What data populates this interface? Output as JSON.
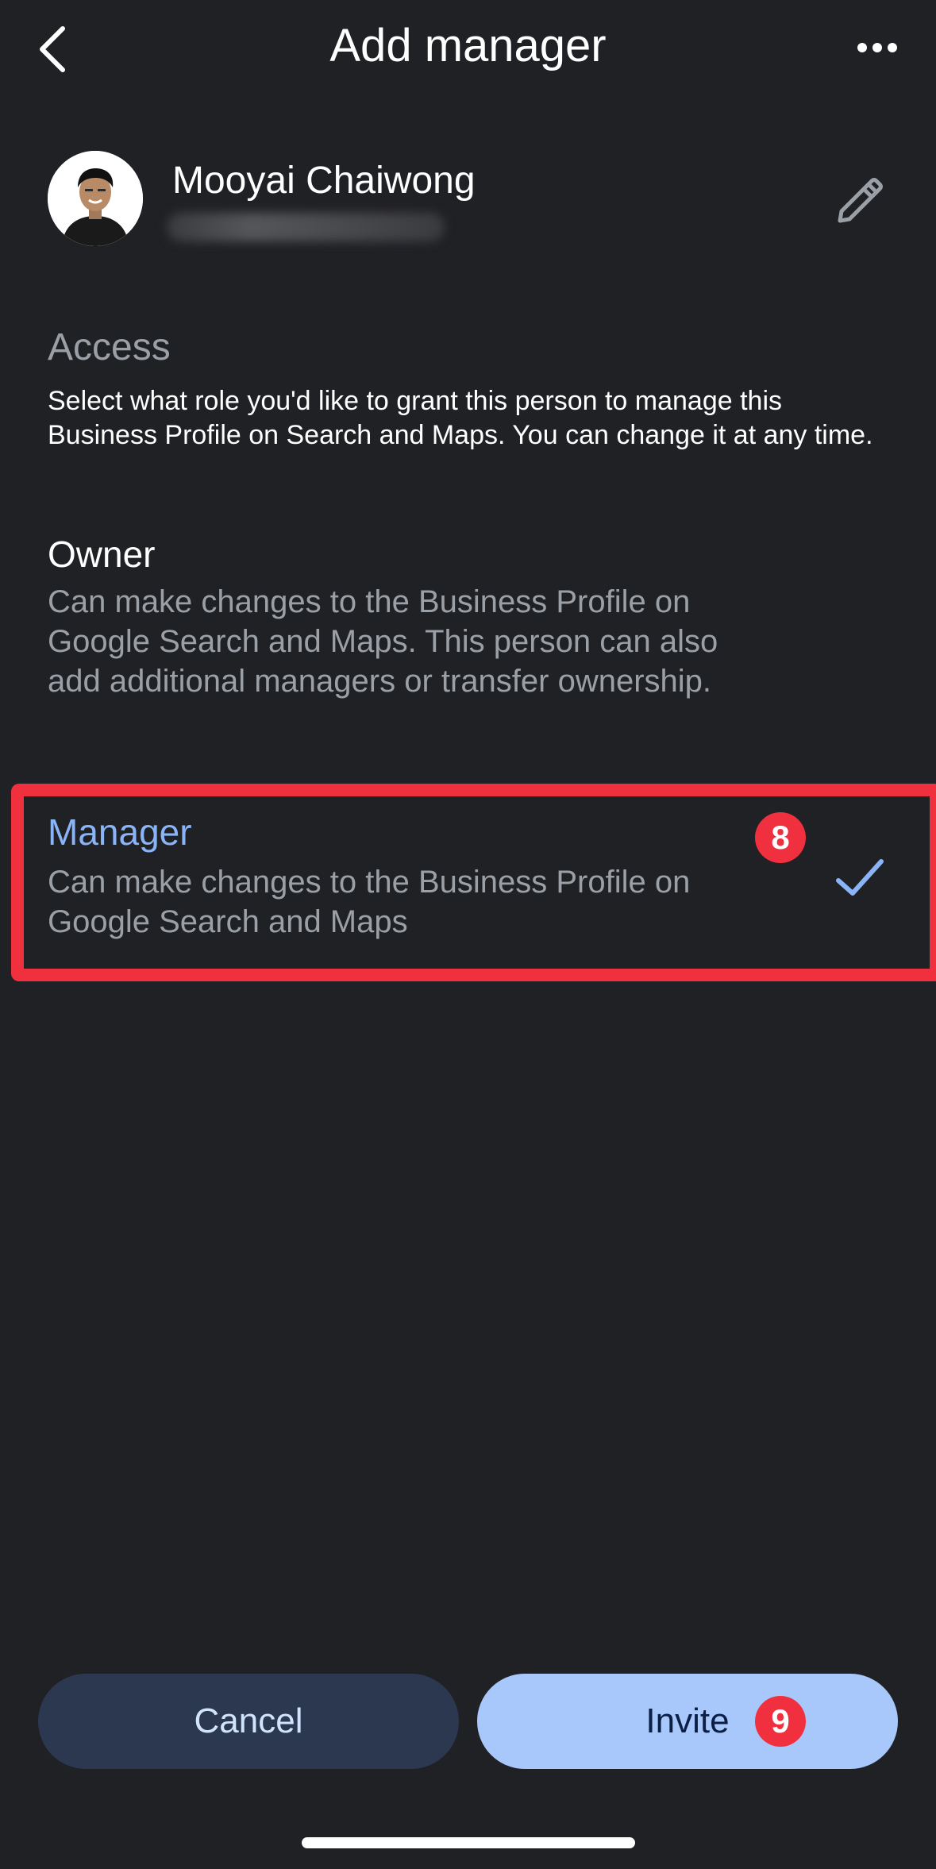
{
  "header": {
    "title": "Add manager",
    "back_icon": "chevron-left-icon",
    "more_icon": "more-horizontal-icon"
  },
  "profile": {
    "name": "Mooyai Chaiwong",
    "edit_icon": "pencil-icon"
  },
  "access": {
    "heading": "Access",
    "description": "Select what role you'd like to grant this person to manage this Business Profile on Search and Maps. You can change it at any time.",
    "roles": [
      {
        "title": "Owner",
        "description": "Can make changes to the Business Profile on Google Search and Maps. This person can also add additional managers or transfer ownership.",
        "selected": false
      },
      {
        "title": "Manager",
        "description": "Can make changes to the Business Profile on Google Search and Maps",
        "selected": true
      }
    ]
  },
  "annotations": {
    "step_manager": "8",
    "step_invite": "9"
  },
  "actions": {
    "cancel_label": "Cancel",
    "invite_label": "Invite"
  },
  "colors": {
    "background": "#202125",
    "accent": "#8ab4f8",
    "highlight": "#f0303f",
    "invite_button": "#a8c7fa",
    "cancel_button": "#2b3850"
  }
}
